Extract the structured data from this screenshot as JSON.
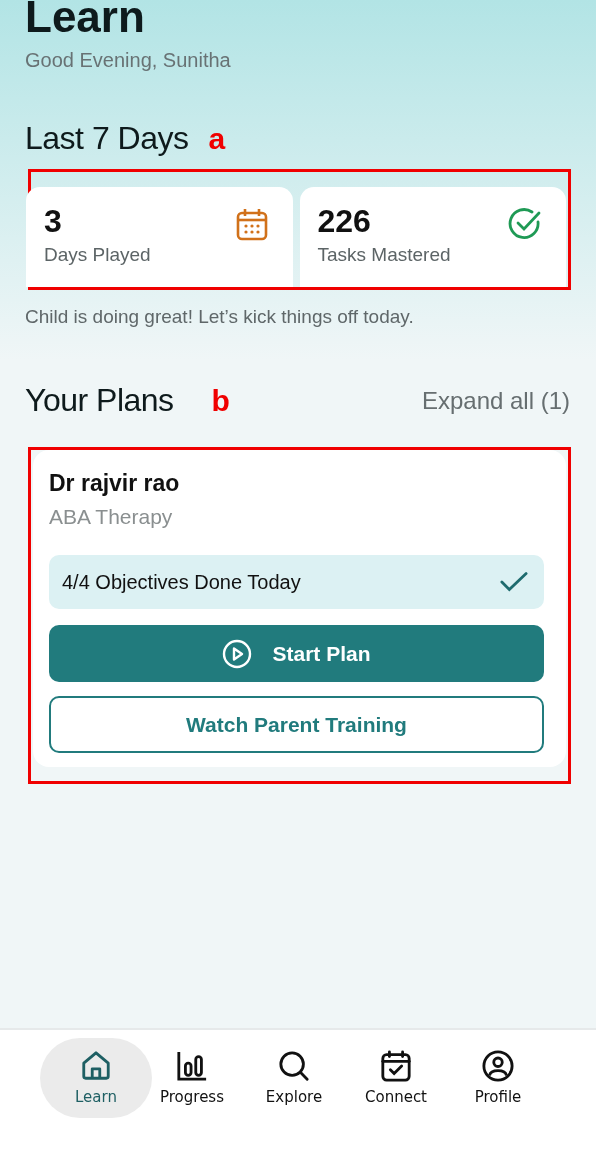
{
  "header": {
    "title": "Learn",
    "greeting": "Good Evening, Sunitha"
  },
  "stats": {
    "title": "Last 7 Days",
    "annotation": "a",
    "cards": [
      {
        "value": "3",
        "label": "Days Played",
        "kind": "calendar"
      },
      {
        "value": "226",
        "label": "Tasks Mastered",
        "kind": "check"
      }
    ],
    "message": "Child is doing great! Let’s kick things off today."
  },
  "plans": {
    "title": "Your Plans",
    "annotation": "b",
    "expand": "Expand all (1)",
    "items": [
      {
        "doctor": "Dr rajvir rao",
        "therapy": "ABA Therapy",
        "objectives": "4/4 Objectives Done Today",
        "done": true,
        "start": "Start Plan",
        "training": "Watch Parent Training"
      }
    ]
  },
  "nav": [
    {
      "label": "Learn",
      "kind": "home",
      "selected": true
    },
    {
      "label": "Progress",
      "kind": "chart",
      "selected": false
    },
    {
      "label": "Explore",
      "kind": "search",
      "selected": false
    },
    {
      "label": "Connect",
      "kind": "calendar",
      "selected": false
    },
    {
      "label": "Profile",
      "kind": "profile",
      "selected": false
    }
  ]
}
